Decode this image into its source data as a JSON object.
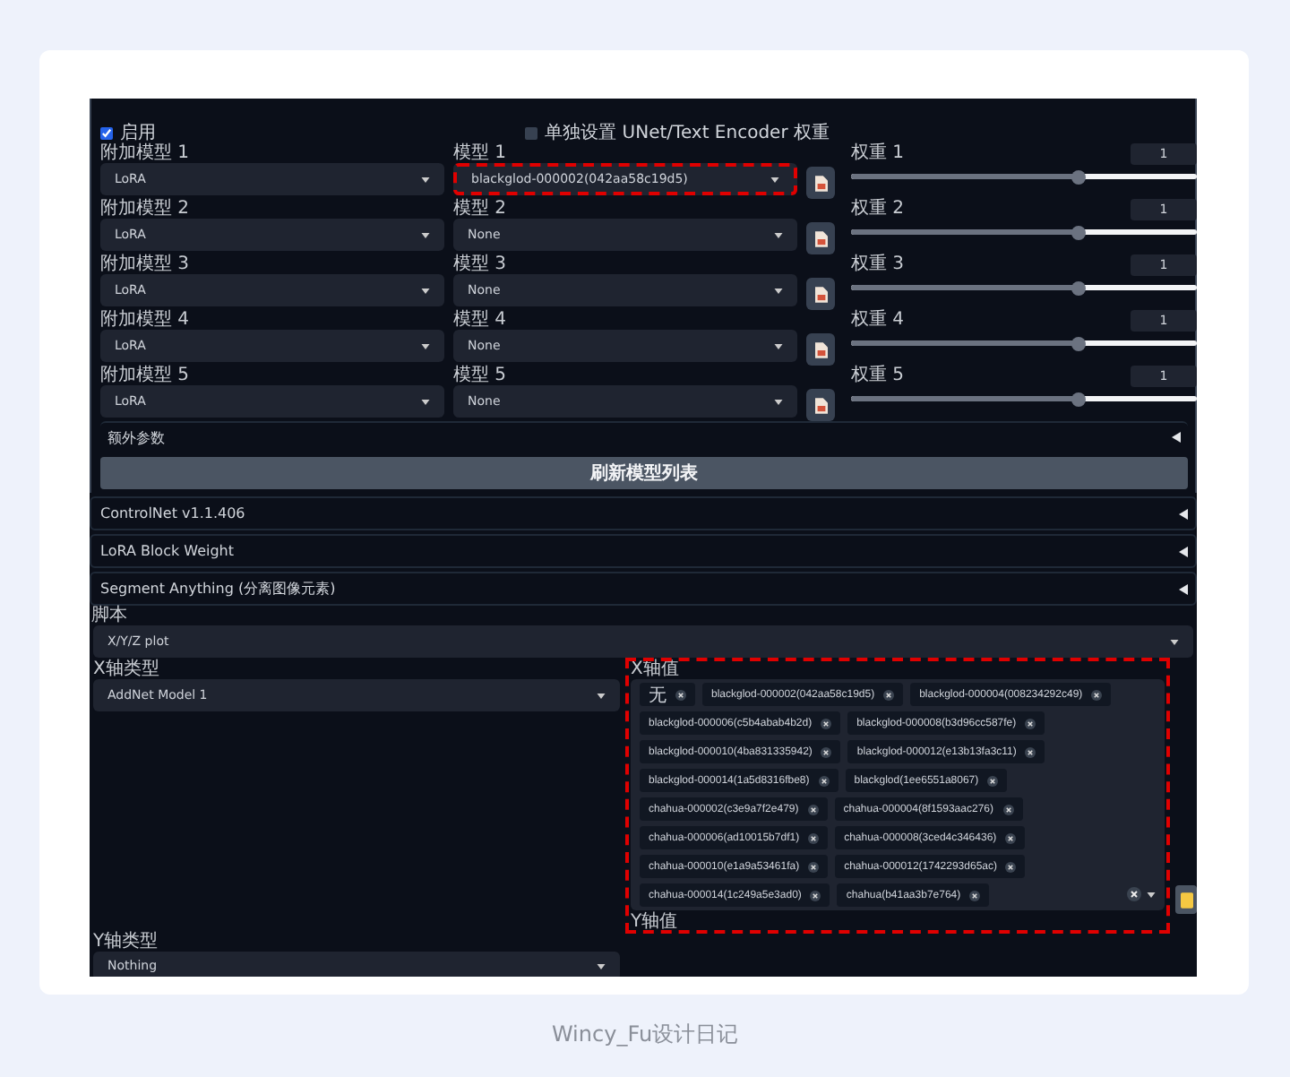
{
  "addnet": {
    "enable": {
      "label": "启用",
      "checked": true
    },
    "separate": {
      "label": "单独设置 UNet/Text Encoder 权重",
      "checked": false
    },
    "rows": [
      {
        "type_label": "附加模型 1",
        "type_value": "LoRA",
        "model_label": "模型 1",
        "model_value": "blackglod-000002(042aa58c19d5)",
        "highlighted": true,
        "weight_label": "权重 1",
        "weight_value": "1",
        "level": 0.66
      },
      {
        "type_label": "附加模型 2",
        "type_value": "LoRA",
        "model_label": "模型 2",
        "model_value": "None",
        "highlighted": false,
        "weight_label": "权重 2",
        "weight_value": "1",
        "level": 0.66
      },
      {
        "type_label": "附加模型 3",
        "type_value": "LoRA",
        "model_label": "模型 3",
        "model_value": "None",
        "highlighted": false,
        "weight_label": "权重 3",
        "weight_value": "1",
        "level": 0.66
      },
      {
        "type_label": "附加模型 4",
        "type_value": "LoRA",
        "model_label": "模型 4",
        "model_value": "None",
        "highlighted": false,
        "weight_label": "权重 4",
        "weight_value": "1",
        "level": 0.66
      },
      {
        "type_label": "附加模型 5",
        "type_value": "LoRA",
        "model_label": "模型 5",
        "model_value": "None",
        "highlighted": false,
        "weight_label": "权重 5",
        "weight_value": "1",
        "level": 0.66
      }
    ],
    "extra": {
      "title": "额外参数",
      "expanded": false
    },
    "refresh": "刷新模型列表"
  },
  "sections": [
    {
      "title": "ControlNet v1.1.406",
      "expanded": false
    },
    {
      "title": "LoRA Block Weight",
      "expanded": false
    },
    {
      "title": "Segment Anything (分离图像元素)",
      "expanded": false
    }
  ],
  "script": {
    "label": "脚本",
    "value": "X/Y/Z plot"
  },
  "x_type": {
    "label": "X轴类型",
    "value": "AddNet Model 1"
  },
  "x_values": {
    "label": "X轴值",
    "highlighted": true,
    "tags": [
      "无",
      "blackglod-000002(042aa58c19d5)",
      "blackglod-000004(008234292c49)",
      "blackglod-000006(c5b4abab4b2d)",
      "blackglod-000008(b3d96cc587fe)",
      "blackglod-000010(4ba831335942)",
      "blackglod-000012(e13b13fa3c11)",
      "blackglod-000014(1a5d8316fbe8)",
      "blackglod(1ee6551a8067)",
      "chahua-000002(c3e9a7f2e479)",
      "chahua-000004(8f1593aac276)",
      "chahua-000006(ad10015b7df1)",
      "chahua-000008(3ced4c346436)",
      "chahua-000010(e1a9a53461fa)",
      "chahua-000012(1742293d65ac)",
      "chahua-000014(1c249a5e3ad0)",
      "chahua(b41aa3b7e764)"
    ]
  },
  "y_type": {
    "label": "Y轴类型",
    "value": "Nothing"
  },
  "y_values": {
    "label": "Y轴值"
  },
  "caption": "Wincy_Fu设计日记"
}
